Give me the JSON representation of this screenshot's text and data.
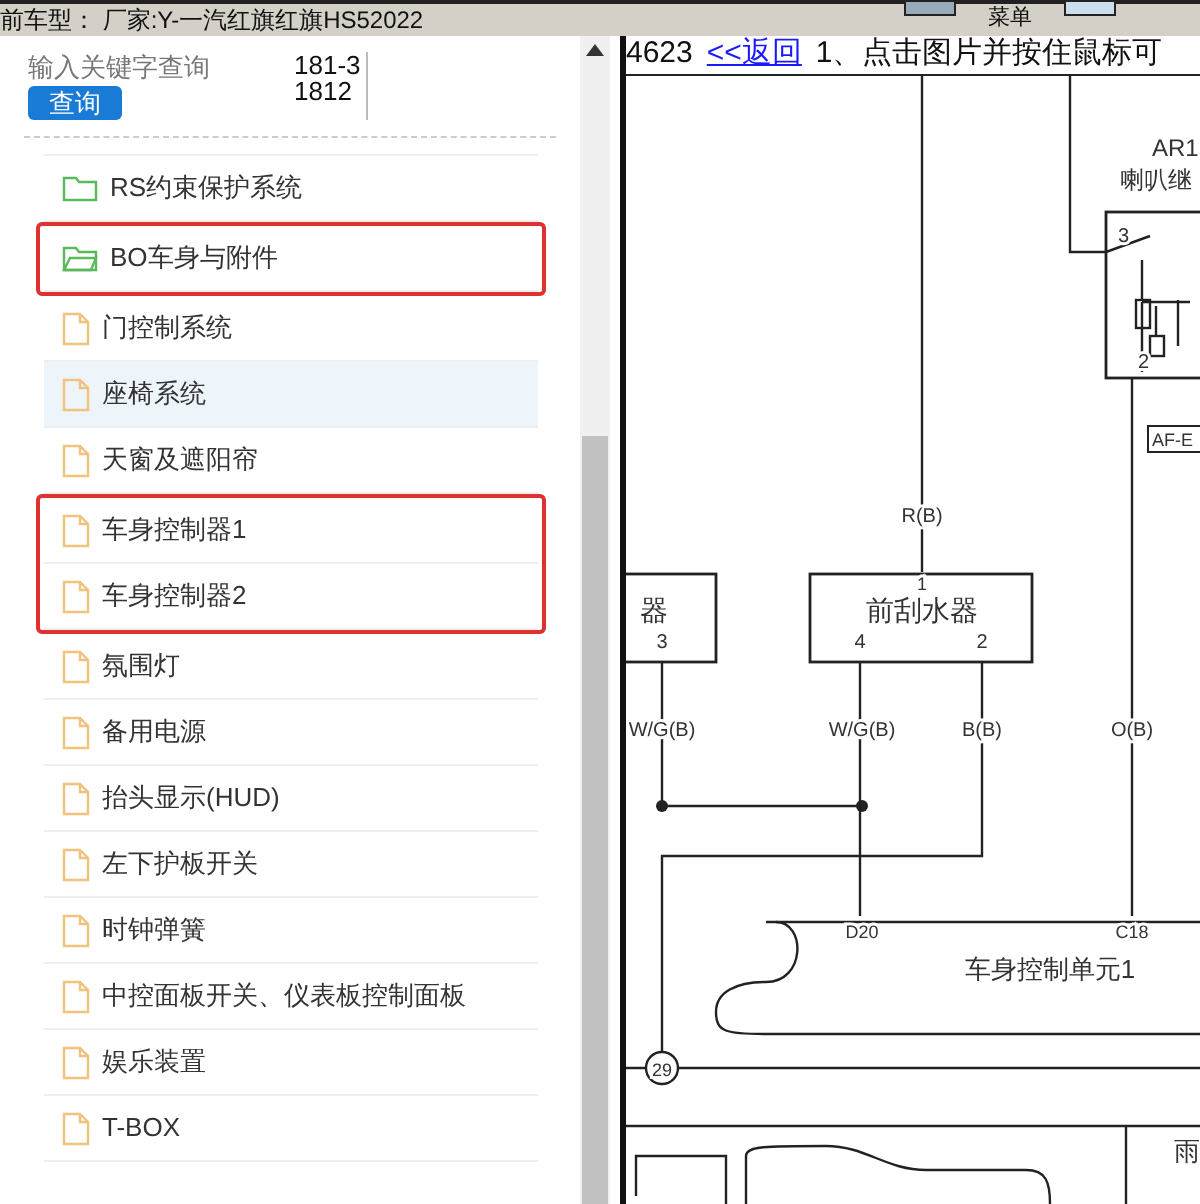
{
  "status_bar": {
    "text": "前车型： 厂家:Y-一汽红旗红旗HS52022"
  },
  "toolbar": {
    "menu_label": "菜单"
  },
  "search": {
    "placeholder": "输入关键字查询",
    "button": "查询",
    "code": "181-31812"
  },
  "tree": {
    "items": [
      {
        "kind": "folder",
        "label": "RS约束保护系统",
        "expanded": false,
        "selected": false,
        "outlined": false
      },
      {
        "kind": "folder",
        "label": "BO车身与附件",
        "expanded": true,
        "selected": false,
        "outlined": true
      },
      {
        "kind": "file",
        "label": "门控制系统",
        "selected": false,
        "outlined": false
      },
      {
        "kind": "file",
        "label": "座椅系统",
        "selected": true,
        "outlined": false
      },
      {
        "kind": "file",
        "label": "天窗及遮阳帘",
        "selected": false,
        "outlined": false
      },
      {
        "kind": "file",
        "label": "车身控制器1",
        "selected": false,
        "outlined": true
      },
      {
        "kind": "file",
        "label": "车身控制器2",
        "selected": false,
        "outlined": true
      },
      {
        "kind": "file",
        "label": "氛围灯",
        "selected": false,
        "outlined": false
      },
      {
        "kind": "file",
        "label": "备用电源",
        "selected": false,
        "outlined": false
      },
      {
        "kind": "file",
        "label": "抬头显示(HUD)",
        "selected": false,
        "outlined": false
      },
      {
        "kind": "file",
        "label": "左下护板开关",
        "selected": false,
        "outlined": false
      },
      {
        "kind": "file",
        "label": "时钟弹簧",
        "selected": false,
        "outlined": false
      },
      {
        "kind": "file",
        "label": "中控面板开关、仪表板控制面板",
        "selected": false,
        "outlined": false
      },
      {
        "kind": "file",
        "label": "娱乐装置",
        "selected": false,
        "outlined": false
      },
      {
        "kind": "file",
        "label": "T-BOX",
        "selected": false,
        "outlined": false
      }
    ]
  },
  "diagram": {
    "header_number": "4623",
    "back_link": "<<返回",
    "instruction": "1、点击图片并按住鼠标可",
    "labels": [
      "AR1",
      "喇叭继",
      "3",
      "2",
      "AF-E",
      "R(B)",
      "1",
      "前刮水器",
      "4",
      "2",
      "器",
      "3",
      "W/G(B)",
      "W/G(B)",
      "B(B)",
      "O(B)",
      "D20",
      "C18",
      "车身控制单元1",
      "29",
      "雨"
    ]
  }
}
